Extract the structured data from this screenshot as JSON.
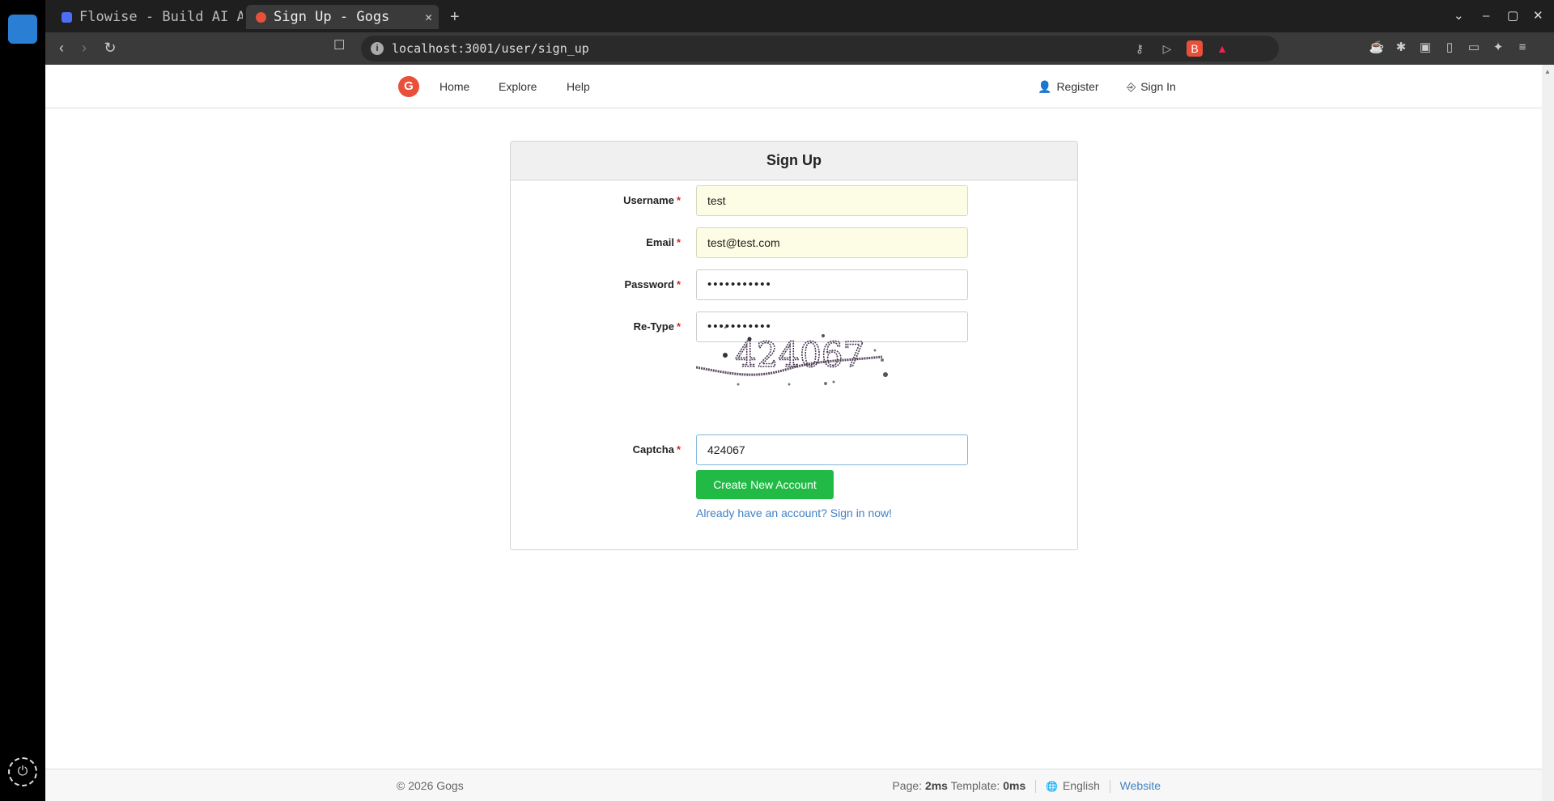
{
  "browser": {
    "tabs": [
      {
        "title": "Flowise - Build AI A",
        "active": false
      },
      {
        "title": "Sign Up - Gogs",
        "active": true
      }
    ],
    "url": "localhost:3001/user/sign_up",
    "new_tab": "+",
    "close_tab": "✕",
    "nav": {
      "back": "‹",
      "forward": "›",
      "reload": "↻"
    },
    "window_controls": {
      "tabs_menu": "⌄",
      "minimize": "–",
      "maximize": "▢",
      "close": "✕"
    },
    "address_icons": {
      "info": "i",
      "key": "⚷",
      "send": "▷",
      "brave_shield": "B",
      "rewards": "▲"
    },
    "extensions": [
      "☕",
      "✱",
      "▣",
      "▯",
      "▭",
      "✦",
      "≡"
    ]
  },
  "dock": {
    "power_icon": "⏻"
  },
  "header": {
    "logo": "G",
    "nav": [
      {
        "label": "Home"
      },
      {
        "label": "Explore"
      },
      {
        "label": "Help"
      }
    ],
    "register": {
      "icon": "👤",
      "label": "Register"
    },
    "sign_in": {
      "icon": "⎆",
      "label": "Sign In"
    }
  },
  "form": {
    "title": "Sign Up",
    "username": {
      "label": "Username",
      "value": "test"
    },
    "email": {
      "label": "Email",
      "value": "test@test.com"
    },
    "password": {
      "label": "Password",
      "value": "•••••••••••"
    },
    "retype": {
      "label": "Re-Type",
      "value": "•••••••••••"
    },
    "captcha_image_text": "424067",
    "captcha": {
      "label": "Captcha",
      "value": "424067"
    },
    "required_mark": "*",
    "submit_label": "Create New Account",
    "signin_link": "Already have an account? Sign in now!"
  },
  "footer": {
    "copyright": "© 2026 Gogs",
    "page_label": "Page:",
    "page_time": "2ms",
    "template_label": "Template:",
    "template_time": "0ms",
    "globe_icon": "🌐",
    "language": "English",
    "website": "Website"
  }
}
